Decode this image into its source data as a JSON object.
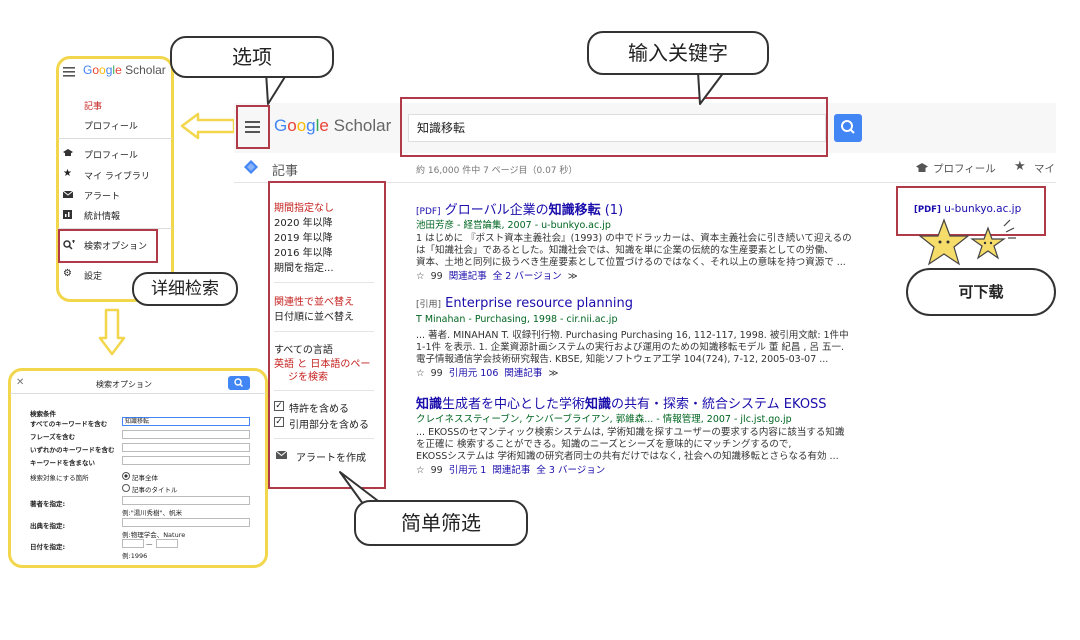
{
  "callouts": {
    "options": "选项",
    "input_keyword": "输入关键字",
    "advanced_search": "详细检索",
    "simple_filter": "简单筛选",
    "downloadable": "可下载"
  },
  "logo": {
    "g1": "G",
    "o1": "o",
    "o2": "o",
    "g2": "g",
    "l": "l",
    "e": "e",
    "scholar": "Scholar"
  },
  "search": {
    "query": "知識移転"
  },
  "tabs": {
    "articles": "記事",
    "profile": "プロフィール",
    "my_library": "マイ"
  },
  "result_stats": "約 16,000 件中 7 ページ目（0.07 秒）",
  "filters": {
    "time": [
      "期間指定なし",
      "2020 年以降",
      "2019 年以降",
      "2016 年以降",
      "期間を指定..."
    ],
    "sort": [
      "関連性で並べ替え",
      "日付順に並べ替え"
    ],
    "lang": [
      "すべての言語",
      "英語 と 日本語のペー",
      "ジを検索"
    ],
    "include_patents": "特許を含める",
    "include_citations": "引用部分を含める",
    "create_alert": "アラートを作成"
  },
  "side_menu": {
    "articles": "記事",
    "profile": "プロフィール",
    "items": [
      "プロフィール",
      "マイ ライブラリ",
      "アラート",
      "統計情報"
    ],
    "advanced": "検索オプション",
    "settings": "設定"
  },
  "advanced_form": {
    "title": "検索オプション",
    "section": "検索条件",
    "labels": [
      "すべてのキーワードを含む",
      "フレーズを含む",
      "いずれかのキーワードを含む",
      "キーワードを含まない",
      "検索対象にする箇所"
    ],
    "all_value": "知識移転",
    "radio1": "記事全体",
    "radio2": "記事のタイトル",
    "author_label": "著者を指定:",
    "author_hint": "例:\"湯川秀樹\"、帆米",
    "pub_label": "出典を指定:",
    "pub_hint": "例:物理学会、Nature",
    "date_label": "日付を指定:",
    "date_dash": "—",
    "date_hint": "例:1996"
  },
  "results": [
    {
      "prefix": "[PDF]",
      "title_a": "グローバル企業の",
      "title_b": "知識移転",
      "title_c": " (1)",
      "source": "池田芳彦 - 経営論集, 2007 - u-bunkyo.ac.jp",
      "snippet": [
        "1 はじめに 『ポスト資本主義社会』(1993) の中でドラッカーは、資本主義社会に引き続いて迎えるの",
        "は「知識社会」であるとした。知識社会では、知識を単に企業の伝統的な生産要素としての労働、",
        "資本、土地と同列に扱うべき生産要素として位置づけるのではなく、それ以上の意味を持つ資源で ..."
      ],
      "links": [
        "関連記事",
        "全 2 バージョン"
      ],
      "side_link_prefix": "[PDF]",
      "side_link": "u-bunkyo.ac.jp"
    },
    {
      "prefix": "[引用]",
      "title_a": "Enterprise resource planning",
      "source": "T Minahan - Purchasing, 1998 - cir.nii.ac.jp",
      "snippet": [
        "... 著者. MINAHAN T. 収録刊行物. Purchasing Purchasing 16, 112-117, 1998. 被引用文献: 1件中",
        "1-1件 を表示. 1. 企業資源計画システムの実行および運用のための知識移転モデル 董 紀昌 , 呂 五一.",
        "電子情報通信学会技術研究報告. KBSE, 知能ソフトウェア工学 104(724), 7-12, 2005-03-07 ..."
      ],
      "links": [
        "引用元 106",
        "関連記事"
      ]
    },
    {
      "title_a": "知識",
      "title_b": "生成者を中心とした学術",
      "title_c": "知識",
      "title_d": "の共有・探索・統合システム EKOSS",
      "source": "クレイネススティーブン, ケンバーブライアン, 郭維森... - 情報管理, 2007 - jlc.jst.go.jp",
      "snippet": [
        "... EKOSSのセマンティック検索システムは, 学術知識を探すユーザーの要求する内容に該当する知識",
        "を正確に 検索することができる。知識のニーズとシーズを意味的にマッチングするので,",
        "EKOSSシステムは 学術知識の研究者同士の共有だけではなく, 社会への知識移転とさらなる有効 ..."
      ],
      "links": [
        "引用元 1",
        "関連記事",
        "全 3 バージョン"
      ]
    }
  ],
  "colors": {
    "red_frame": "#b03a48",
    "yellow_frame": "#f2d64b",
    "link": "#1a0dab",
    "green": "#006621",
    "blue": "#4285f4",
    "filter_red": "#c5221f"
  }
}
